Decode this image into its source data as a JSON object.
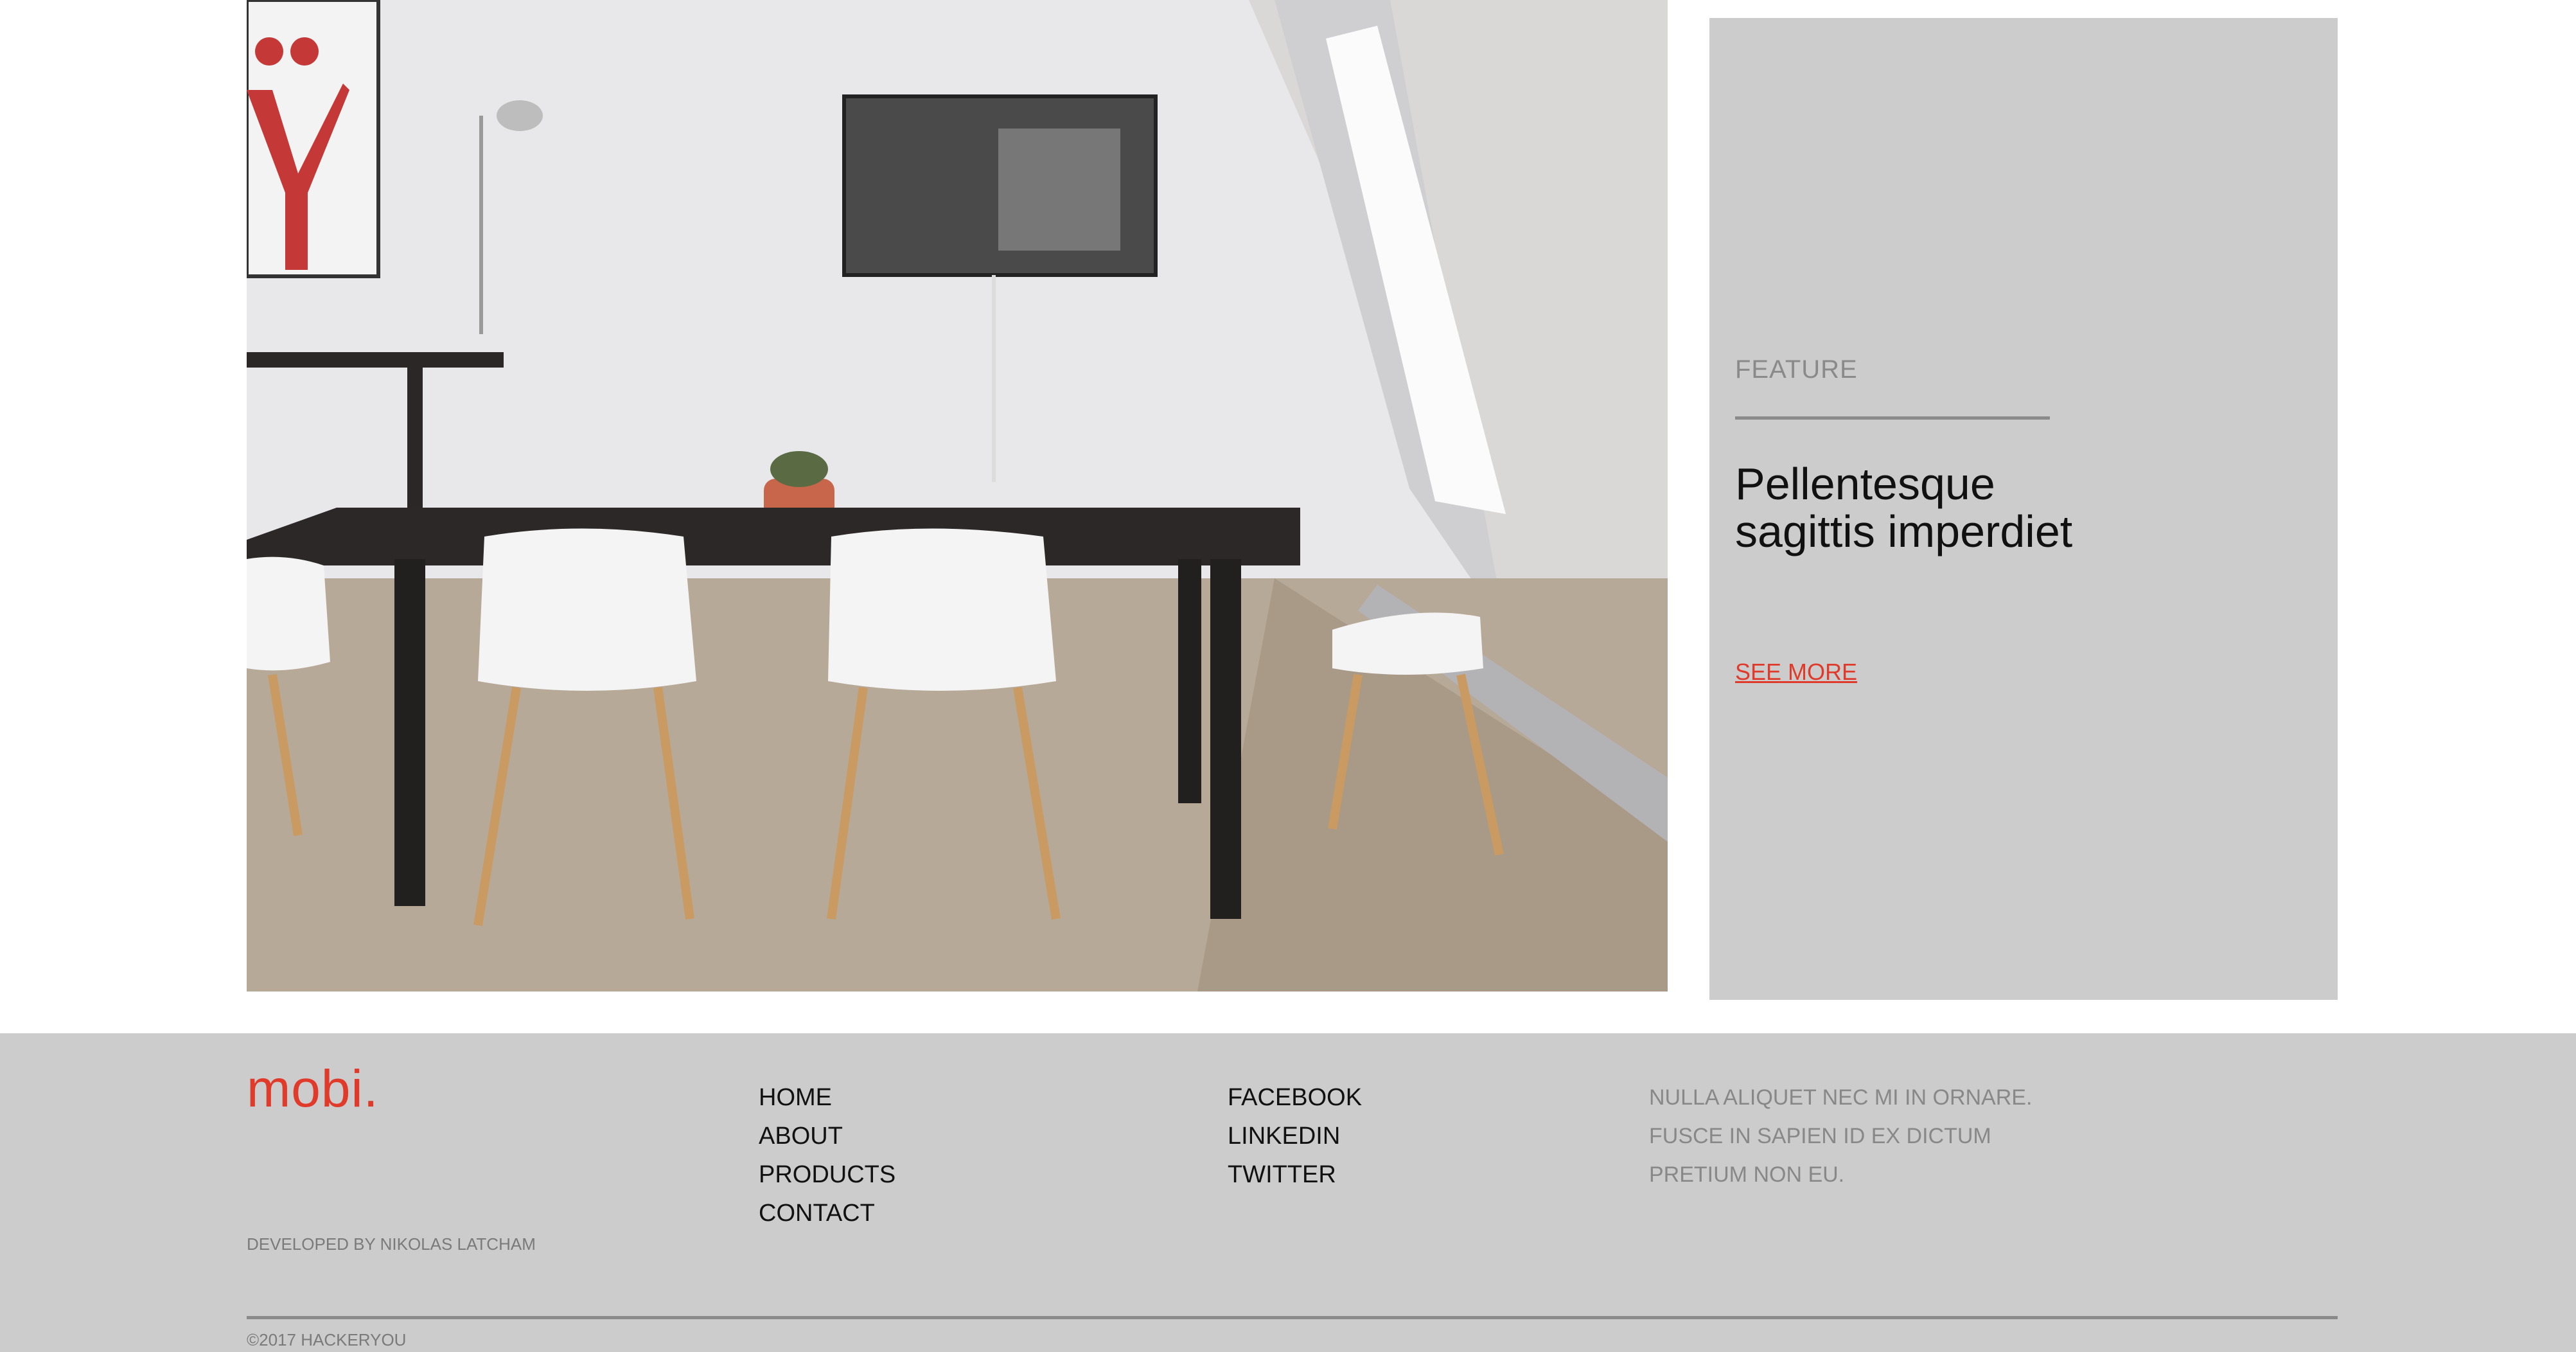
{
  "feature": {
    "label": "FEATURE",
    "title": "Pellentesque sagittis imperdiet",
    "link": "SEE MORE"
  },
  "footer": {
    "logo": "mobi.",
    "credit": "DEVELOPED BY NIKOLAS LATCHAM",
    "nav": [
      "HOME",
      "ABOUT",
      "PRODUCTS",
      "CONTACT"
    ],
    "social": [
      "FACEBOOK",
      "LINKEDIN",
      "TWITTER"
    ],
    "blurb": "NULLA ALIQUET NEC MI IN ORNARE. FUSCE IN SAPIEN ID EX DICTUM PRETIUM NON EU.",
    "copyright": "©2017 HACKERYOU"
  },
  "colors": {
    "accent": "#e03a2a",
    "panel": "#cccccc",
    "muted": "#8a8a8a"
  }
}
